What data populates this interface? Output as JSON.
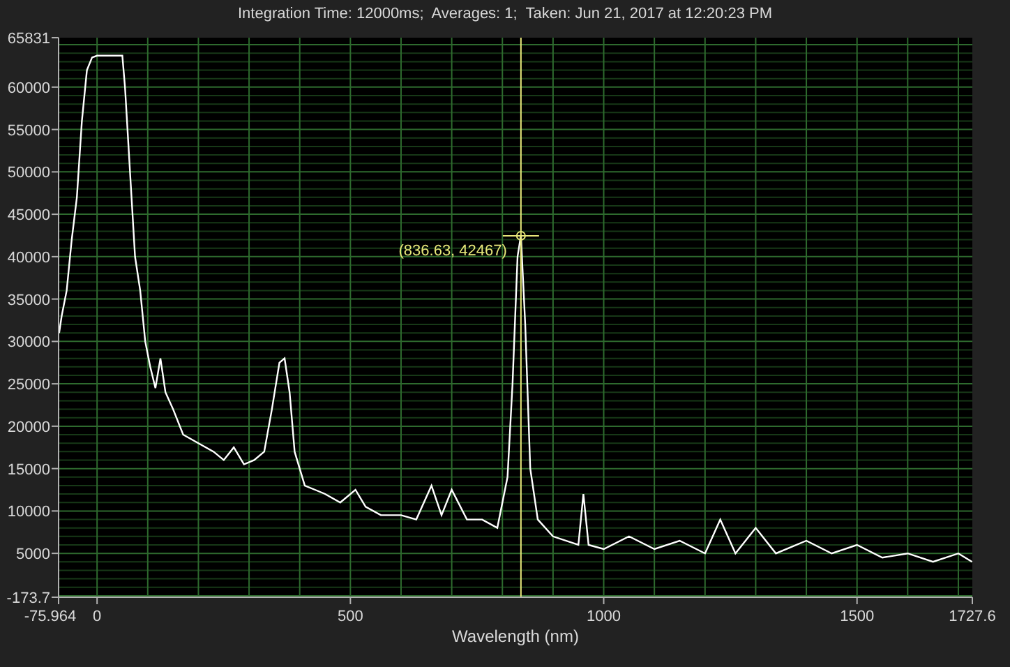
{
  "title": "Integration Time: 12000ms;  Averages: 1;  Taken: Jun 21, 2017 at 12:20:23 PM",
  "chart_data": {
    "type": "line",
    "xlabel": "Wavelength (nm)",
    "xlim": [
      -75.964,
      1727.6
    ],
    "ylim": [
      -173.7,
      65831
    ],
    "xticks": [
      {
        "value": -75.964,
        "label": "-75.964"
      },
      0,
      500,
      1000,
      1500,
      {
        "value": 1727.6,
        "label": "1727.6"
      }
    ],
    "yticks": [
      {
        "value": -173.7,
        "label": "-173.7"
      },
      5000,
      10000,
      15000,
      20000,
      25000,
      30000,
      35000,
      40000,
      45000,
      50000,
      55000,
      60000,
      65831
    ],
    "x": [
      -75,
      -70,
      -60,
      -50,
      -40,
      -30,
      -20,
      -10,
      0,
      20,
      50,
      55,
      65,
      75,
      85,
      95,
      105,
      115,
      125,
      135,
      150,
      170,
      200,
      230,
      250,
      270,
      290,
      310,
      330,
      345,
      360,
      370,
      380,
      390,
      410,
      430,
      450,
      480,
      510,
      530,
      560,
      600,
      630,
      660,
      680,
      700,
      730,
      760,
      790,
      810,
      820,
      830,
      836.63,
      845,
      855,
      870,
      900,
      950,
      960,
      970,
      1000,
      1050,
      1100,
      1150,
      1200,
      1230,
      1260,
      1300,
      1340,
      1400,
      1450,
      1500,
      1550,
      1600,
      1650,
      1700,
      1727
    ],
    "grid": true,
    "ref_lines": [
      {
        "axis": "x",
        "value": 836.63
      }
    ],
    "series": [
      {
        "color": "#ffffff",
        "values": [
          31000,
          33000,
          36000,
          42000,
          47000,
          56000,
          62000,
          63500,
          63700,
          63700,
          63700,
          60000,
          50000,
          40000,
          36000,
          30000,
          27000,
          24500,
          28000,
          24000,
          22000,
          19000,
          18000,
          17000,
          16000,
          17500,
          15500,
          16000,
          17000,
          22000,
          27500,
          28000,
          24000,
          17000,
          13000,
          12500,
          12000,
          11000,
          12500,
          10500,
          9500,
          9500,
          9000,
          13000,
          9500,
          12500,
          9000,
          9000,
          8000,
          14000,
          25000,
          40000,
          42500,
          32000,
          15000,
          9000,
          7000,
          6000,
          12000,
          6000,
          5500,
          7000,
          5500,
          6500,
          5000,
          9000,
          5000,
          8000,
          5000,
          6500,
          5000,
          6000,
          4500,
          5000,
          4000,
          5000,
          4000
        ]
      }
    ],
    "annotations": [
      {
        "x": 836.63,
        "y": 42467,
        "text": "(836.63, 42467)"
      }
    ]
  }
}
